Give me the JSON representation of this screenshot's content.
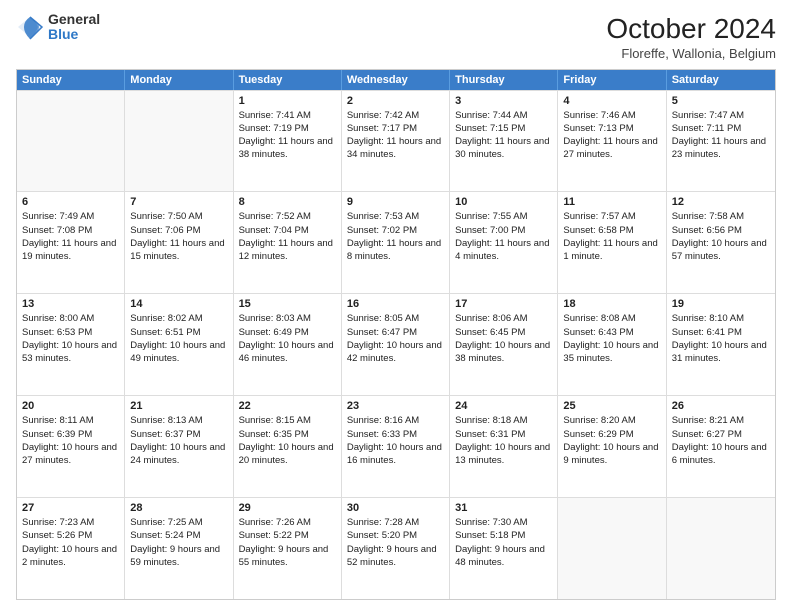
{
  "logo": {
    "general": "General",
    "blue": "Blue"
  },
  "header": {
    "title": "October 2024",
    "subtitle": "Floreffe, Wallonia, Belgium"
  },
  "days_of_week": [
    "Sunday",
    "Monday",
    "Tuesday",
    "Wednesday",
    "Thursday",
    "Friday",
    "Saturday"
  ],
  "weeks": [
    [
      {
        "day": "",
        "empty": true
      },
      {
        "day": "",
        "empty": true
      },
      {
        "day": "1",
        "sunrise": "Sunrise: 7:41 AM",
        "sunset": "Sunset: 7:19 PM",
        "daylight": "Daylight: 11 hours and 38 minutes."
      },
      {
        "day": "2",
        "sunrise": "Sunrise: 7:42 AM",
        "sunset": "Sunset: 7:17 PM",
        "daylight": "Daylight: 11 hours and 34 minutes."
      },
      {
        "day": "3",
        "sunrise": "Sunrise: 7:44 AM",
        "sunset": "Sunset: 7:15 PM",
        "daylight": "Daylight: 11 hours and 30 minutes."
      },
      {
        "day": "4",
        "sunrise": "Sunrise: 7:46 AM",
        "sunset": "Sunset: 7:13 PM",
        "daylight": "Daylight: 11 hours and 27 minutes."
      },
      {
        "day": "5",
        "sunrise": "Sunrise: 7:47 AM",
        "sunset": "Sunset: 7:11 PM",
        "daylight": "Daylight: 11 hours and 23 minutes."
      }
    ],
    [
      {
        "day": "6",
        "sunrise": "Sunrise: 7:49 AM",
        "sunset": "Sunset: 7:08 PM",
        "daylight": "Daylight: 11 hours and 19 minutes."
      },
      {
        "day": "7",
        "sunrise": "Sunrise: 7:50 AM",
        "sunset": "Sunset: 7:06 PM",
        "daylight": "Daylight: 11 hours and 15 minutes."
      },
      {
        "day": "8",
        "sunrise": "Sunrise: 7:52 AM",
        "sunset": "Sunset: 7:04 PM",
        "daylight": "Daylight: 11 hours and 12 minutes."
      },
      {
        "day": "9",
        "sunrise": "Sunrise: 7:53 AM",
        "sunset": "Sunset: 7:02 PM",
        "daylight": "Daylight: 11 hours and 8 minutes."
      },
      {
        "day": "10",
        "sunrise": "Sunrise: 7:55 AM",
        "sunset": "Sunset: 7:00 PM",
        "daylight": "Daylight: 11 hours and 4 minutes."
      },
      {
        "day": "11",
        "sunrise": "Sunrise: 7:57 AM",
        "sunset": "Sunset: 6:58 PM",
        "daylight": "Daylight: 11 hours and 1 minute."
      },
      {
        "day": "12",
        "sunrise": "Sunrise: 7:58 AM",
        "sunset": "Sunset: 6:56 PM",
        "daylight": "Daylight: 10 hours and 57 minutes."
      }
    ],
    [
      {
        "day": "13",
        "sunrise": "Sunrise: 8:00 AM",
        "sunset": "Sunset: 6:53 PM",
        "daylight": "Daylight: 10 hours and 53 minutes."
      },
      {
        "day": "14",
        "sunrise": "Sunrise: 8:02 AM",
        "sunset": "Sunset: 6:51 PM",
        "daylight": "Daylight: 10 hours and 49 minutes."
      },
      {
        "day": "15",
        "sunrise": "Sunrise: 8:03 AM",
        "sunset": "Sunset: 6:49 PM",
        "daylight": "Daylight: 10 hours and 46 minutes."
      },
      {
        "day": "16",
        "sunrise": "Sunrise: 8:05 AM",
        "sunset": "Sunset: 6:47 PM",
        "daylight": "Daylight: 10 hours and 42 minutes."
      },
      {
        "day": "17",
        "sunrise": "Sunrise: 8:06 AM",
        "sunset": "Sunset: 6:45 PM",
        "daylight": "Daylight: 10 hours and 38 minutes."
      },
      {
        "day": "18",
        "sunrise": "Sunrise: 8:08 AM",
        "sunset": "Sunset: 6:43 PM",
        "daylight": "Daylight: 10 hours and 35 minutes."
      },
      {
        "day": "19",
        "sunrise": "Sunrise: 8:10 AM",
        "sunset": "Sunset: 6:41 PM",
        "daylight": "Daylight: 10 hours and 31 minutes."
      }
    ],
    [
      {
        "day": "20",
        "sunrise": "Sunrise: 8:11 AM",
        "sunset": "Sunset: 6:39 PM",
        "daylight": "Daylight: 10 hours and 27 minutes."
      },
      {
        "day": "21",
        "sunrise": "Sunrise: 8:13 AM",
        "sunset": "Sunset: 6:37 PM",
        "daylight": "Daylight: 10 hours and 24 minutes."
      },
      {
        "day": "22",
        "sunrise": "Sunrise: 8:15 AM",
        "sunset": "Sunset: 6:35 PM",
        "daylight": "Daylight: 10 hours and 20 minutes."
      },
      {
        "day": "23",
        "sunrise": "Sunrise: 8:16 AM",
        "sunset": "Sunset: 6:33 PM",
        "daylight": "Daylight: 10 hours and 16 minutes."
      },
      {
        "day": "24",
        "sunrise": "Sunrise: 8:18 AM",
        "sunset": "Sunset: 6:31 PM",
        "daylight": "Daylight: 10 hours and 13 minutes."
      },
      {
        "day": "25",
        "sunrise": "Sunrise: 8:20 AM",
        "sunset": "Sunset: 6:29 PM",
        "daylight": "Daylight: 10 hours and 9 minutes."
      },
      {
        "day": "26",
        "sunrise": "Sunrise: 8:21 AM",
        "sunset": "Sunset: 6:27 PM",
        "daylight": "Daylight: 10 hours and 6 minutes."
      }
    ],
    [
      {
        "day": "27",
        "sunrise": "Sunrise: 7:23 AM",
        "sunset": "Sunset: 5:26 PM",
        "daylight": "Daylight: 10 hours and 2 minutes."
      },
      {
        "day": "28",
        "sunrise": "Sunrise: 7:25 AM",
        "sunset": "Sunset: 5:24 PM",
        "daylight": "Daylight: 9 hours and 59 minutes."
      },
      {
        "day": "29",
        "sunrise": "Sunrise: 7:26 AM",
        "sunset": "Sunset: 5:22 PM",
        "daylight": "Daylight: 9 hours and 55 minutes."
      },
      {
        "day": "30",
        "sunrise": "Sunrise: 7:28 AM",
        "sunset": "Sunset: 5:20 PM",
        "daylight": "Daylight: 9 hours and 52 minutes."
      },
      {
        "day": "31",
        "sunrise": "Sunrise: 7:30 AM",
        "sunset": "Sunset: 5:18 PM",
        "daylight": "Daylight: 9 hours and 48 minutes."
      },
      {
        "day": "",
        "empty": true
      },
      {
        "day": "",
        "empty": true
      }
    ]
  ]
}
